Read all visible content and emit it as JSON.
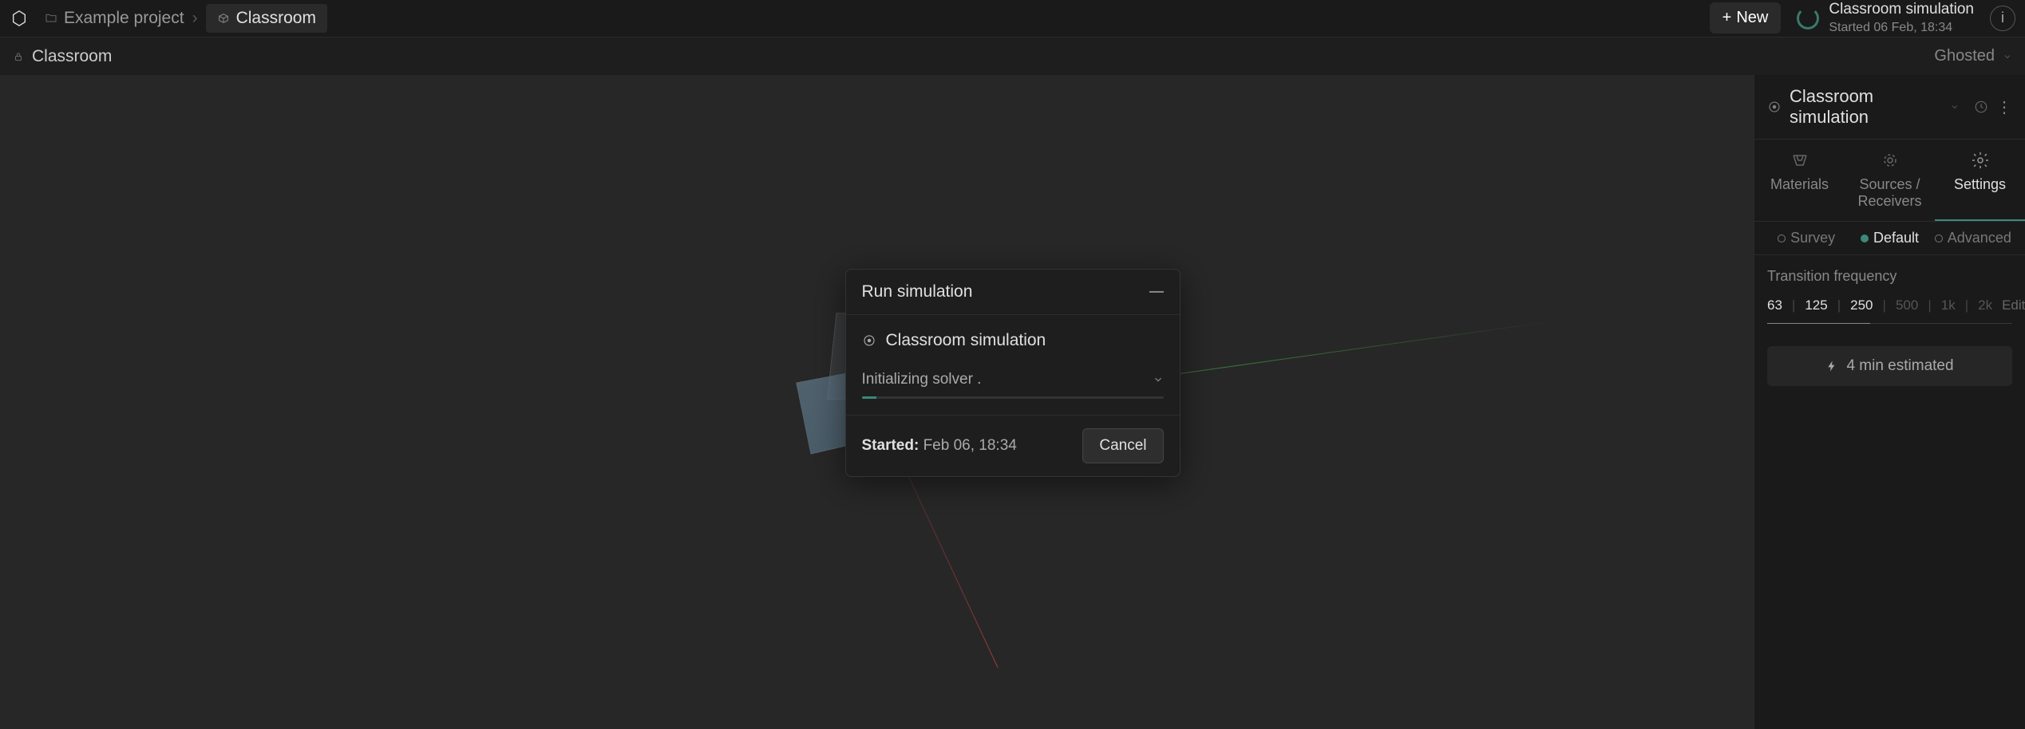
{
  "topbar": {
    "breadcrumbs": {
      "project": "Example project",
      "model": "Classroom",
      "separator": "›"
    },
    "new_button": "New",
    "sim_status": {
      "title": "Classroom simulation",
      "subtitle": "Started 06 Feb, 18:34"
    }
  },
  "subheader": {
    "title": "Classroom",
    "view_mode": "Ghosted"
  },
  "right_panel": {
    "header_title": "Classroom simulation",
    "tabs": {
      "materials": "Materials",
      "sources": "Sources / Receivers",
      "settings": "Settings"
    },
    "sub_tabs": {
      "survey": "Survey",
      "default": "Default",
      "advanced": "Advanced"
    },
    "freq_section": {
      "label": "Transition frequency",
      "values": [
        "63",
        "125",
        "250",
        "500",
        "1k",
        "2k"
      ],
      "active_count": 3,
      "edit": "Edit"
    },
    "estimate": "4 min estimated"
  },
  "modal": {
    "title": "Run simulation",
    "sim_name": "Classroom simulation",
    "status_text": "Initializing solver .",
    "started_label": "Started:",
    "started_value": "Feb 06, 18:34",
    "cancel": "Cancel"
  }
}
